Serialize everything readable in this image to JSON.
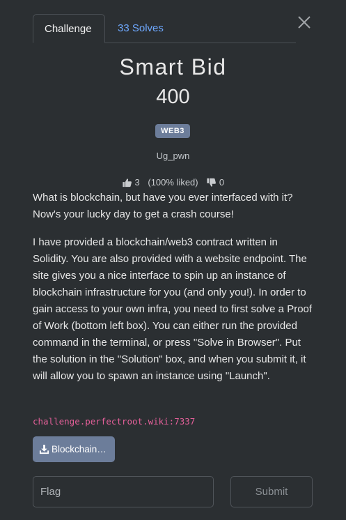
{
  "tabs": [
    {
      "label": "Challenge"
    },
    {
      "label": "33 Solves"
    }
  ],
  "challenge": {
    "title": "Smart Bid",
    "points": "400",
    "category": "WEB3",
    "author": "Ug_pwn",
    "likes": "3",
    "liked_pct": "(100% liked)",
    "dislikes": "0",
    "description": [
      "What is blockchain, but have you ever interfaced with it? Now's your lucky day to get a crash course!",
      "I have provided a blockchain/web3 contract written in Solidity. You are also provided with a website endpoint. The site gives you a nice interface to spin up an instance of blockchain infrastructure for you (and only you!). In order to gain access to your own infra, you need to first solve a Proof of Work (bottom left box). You can either run the provided command in the terminal, or press \"Solve in Browser\". Put the solution in the \"Solution\" box, and when you submit it, it will allow you to spawn an instance using \"Launch\"."
    ],
    "endpoint": "challenge.perfectroot.wiki:7337",
    "file_button": "Blockchain…"
  },
  "form": {
    "flag_placeholder": "Flag",
    "submit_label": "Submit"
  },
  "icons": {
    "close": "close-icon",
    "thumbs_up": "thumbs-up-icon",
    "thumbs_down": "thumbs-down-icon",
    "download": "download-icon"
  }
}
